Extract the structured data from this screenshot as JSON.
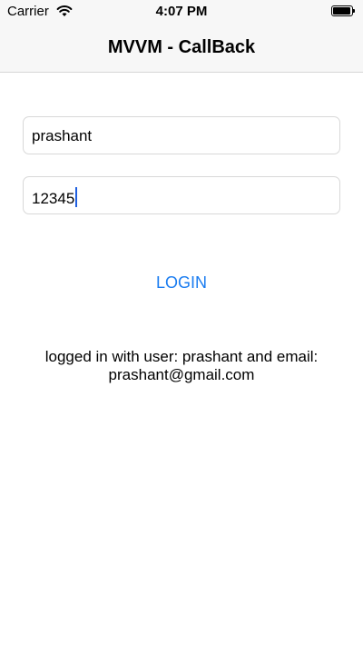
{
  "status_bar": {
    "carrier": "Carrier",
    "time": "4:07 PM",
    "icons": [
      "wifi-icon",
      "battery-icon"
    ]
  },
  "nav": {
    "title": "MVVM - CallBack"
  },
  "form": {
    "username_value": "prashant",
    "password_value": "12345",
    "login_label": "LOGIN"
  },
  "result": {
    "line1": "logged in with user: prashant and email:",
    "line2": "prashant@gmail.com"
  },
  "colors": {
    "accent": "#1a7cf0",
    "caret": "#1f5fe0"
  }
}
